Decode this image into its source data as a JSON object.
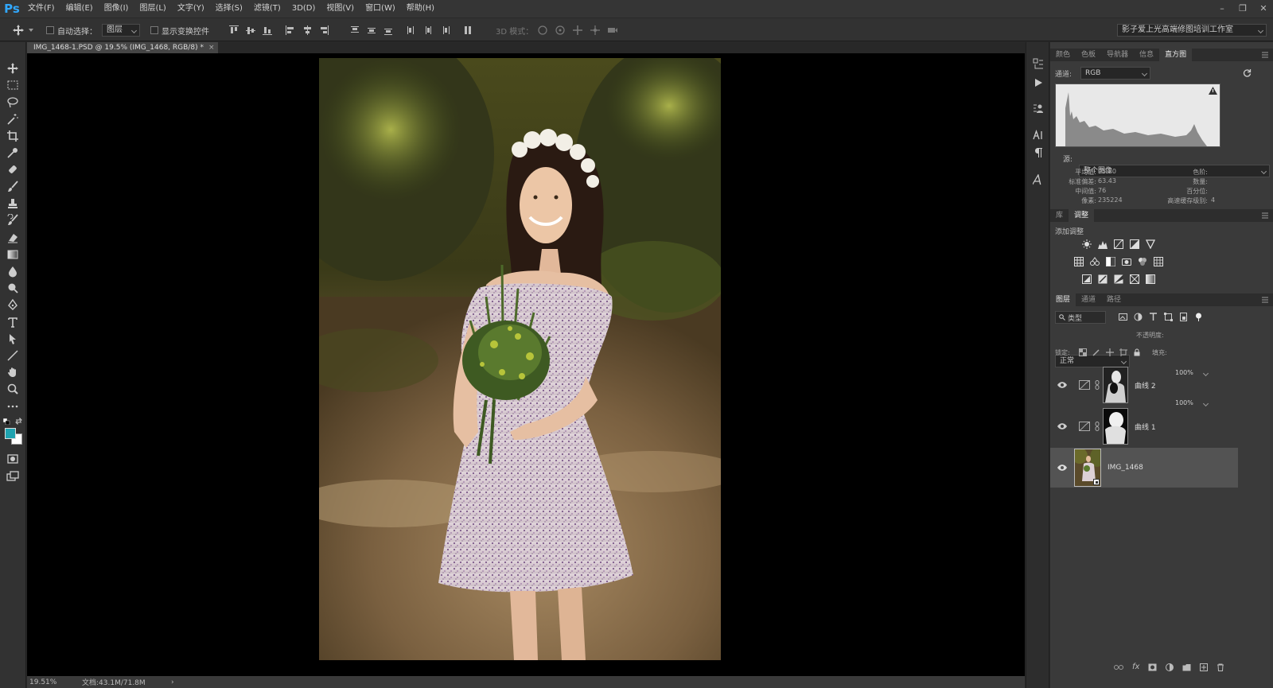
{
  "app": {
    "logo": "Ps",
    "menu": [
      "文件(F)",
      "编辑(E)",
      "图像(I)",
      "图层(L)",
      "文字(Y)",
      "选择(S)",
      "滤镜(T)",
      "3D(D)",
      "视图(V)",
      "窗口(W)",
      "帮助(H)"
    ],
    "workspace": "影子爱上光高端修图培训工作室"
  },
  "options": {
    "auto_select_label": "自动选择：",
    "auto_select_target": "图层",
    "show_transform_label": "显示变换控件",
    "mode_3d_label": "3D 模式："
  },
  "document": {
    "tab_title": "IMG_1468-1.PSD @ 19.5% (IMG_1468, RGB/8) *",
    "zoom": "19.51%",
    "doc_size": "文档:43.1M/71.8M"
  },
  "histogram_panel": {
    "tabs": [
      "颜色",
      "色板",
      "导航器",
      "信息",
      "直方图"
    ],
    "active_tab": "直方图",
    "channel_label": "通道:",
    "channel_value": "RGB",
    "source_label": "源:",
    "source_value": "整个图像",
    "stats": {
      "mean_label": "平均值:",
      "mean_value": "95.20",
      "std_label": "标准偏差:",
      "std_value": "63.43",
      "median_label": "中间值:",
      "median_value": "76",
      "pixels_label": "像素:",
      "pixels_value": "235224",
      "level_label": "色阶:",
      "count_label": "数量:",
      "percentile_label": "百分位:",
      "cache_label": "高速缓存级别:",
      "cache_value": "4"
    }
  },
  "adjustments_panel": {
    "tabs": [
      "库",
      "调整"
    ],
    "active_tab": "调整",
    "add_label": "添加调整"
  },
  "layers_panel": {
    "tabs": [
      "图层",
      "通道",
      "路径"
    ],
    "active_tab": "图层",
    "filter_label": "类型",
    "blend_mode": "正常",
    "opacity_label": "不透明度:",
    "opacity_value": "100%",
    "lock_label": "锁定:",
    "fill_label": "填充:",
    "fill_value": "100%",
    "layers": [
      {
        "name": "曲线 2"
      },
      {
        "name": "曲线 1"
      },
      {
        "name": "IMG_1468"
      }
    ]
  },
  "colors": {
    "foreground": "#1fa3b0",
    "background": "#ffffff",
    "accent": "#31a8ff"
  }
}
